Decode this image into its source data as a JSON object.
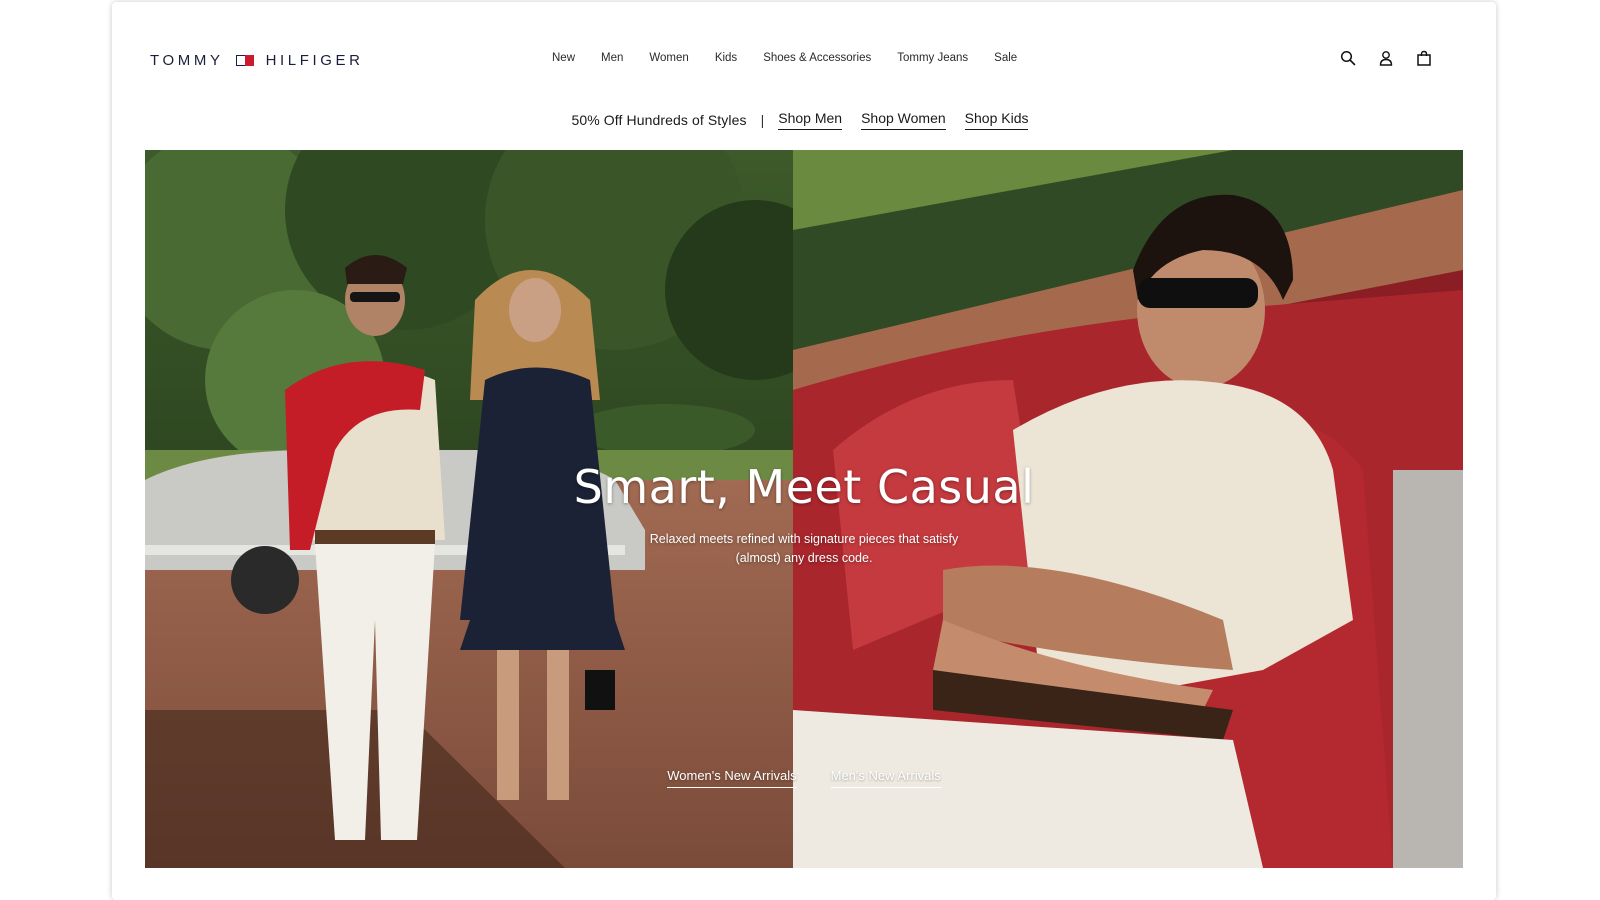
{
  "brand": {
    "left": "TOMMY",
    "right": "HILFIGER"
  },
  "nav": {
    "items": [
      "New",
      "Men",
      "Women",
      "Kids",
      "Shoes & Accessories",
      "Tommy Jeans",
      "Sale"
    ]
  },
  "utility": {
    "icons": [
      "search-icon",
      "account-icon",
      "bag-icon"
    ]
  },
  "promo": {
    "headline": "50% Off Hundreds of Styles",
    "separator": "|",
    "links": [
      "Shop Men",
      "Shop Women",
      "Shop Kids"
    ]
  },
  "hero": {
    "title": "Smart, Meet Casual",
    "subtitle": "Relaxed meets refined with signature pieces that satisfy (almost) any dress code.",
    "ctas": [
      "Women's New Arrivals",
      "Men's New Arrivals"
    ]
  },
  "colors": {
    "brand_navy": "#16214b",
    "brand_red": "#cc1a2f",
    "text": "#1a1a1a"
  }
}
